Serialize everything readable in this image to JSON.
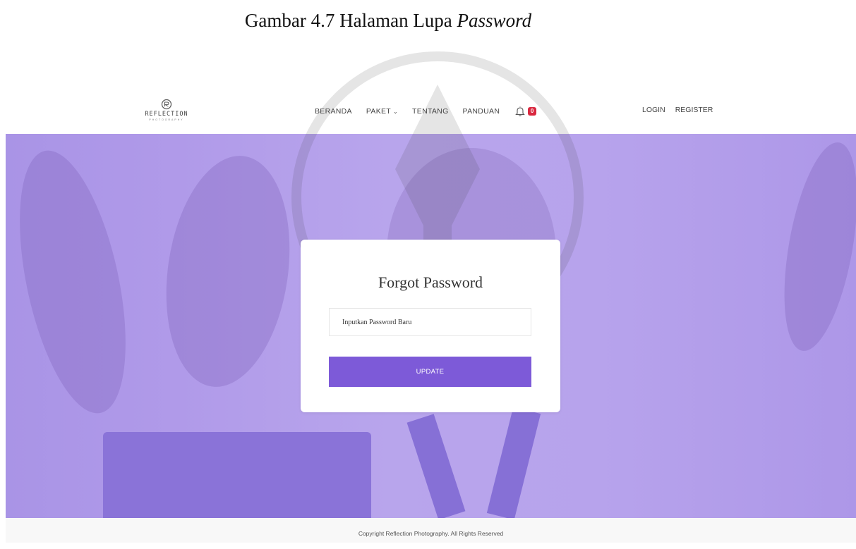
{
  "caption": {
    "prefix": "Gambar 4.7 Halaman Lupa ",
    "italic": "Password"
  },
  "brand": {
    "name": "REFLECTION",
    "tagline": "PHOTOGRAPHY"
  },
  "nav": {
    "items": [
      {
        "label": "BERANDA"
      },
      {
        "label": "PAKET",
        "dropdown": true
      },
      {
        "label": "TENTANG"
      },
      {
        "label": "PANDUAN"
      }
    ],
    "notification_count": "0",
    "login": "LOGIN",
    "register": "REGISTER"
  },
  "form": {
    "title": "Forgot Password",
    "password_placeholder": "Inputkan Password Baru",
    "submit_label": "UPDATE"
  },
  "footer": {
    "text": "Copyright Reflection Photography. All Rights Reserved"
  },
  "colors": {
    "hero_overlay": "#b39ee9",
    "button": "#7d5ad8",
    "badge": "#d9283f"
  },
  "icons": [
    "reflection-logo-icon",
    "bell-icon",
    "chevron-down-icon"
  ]
}
